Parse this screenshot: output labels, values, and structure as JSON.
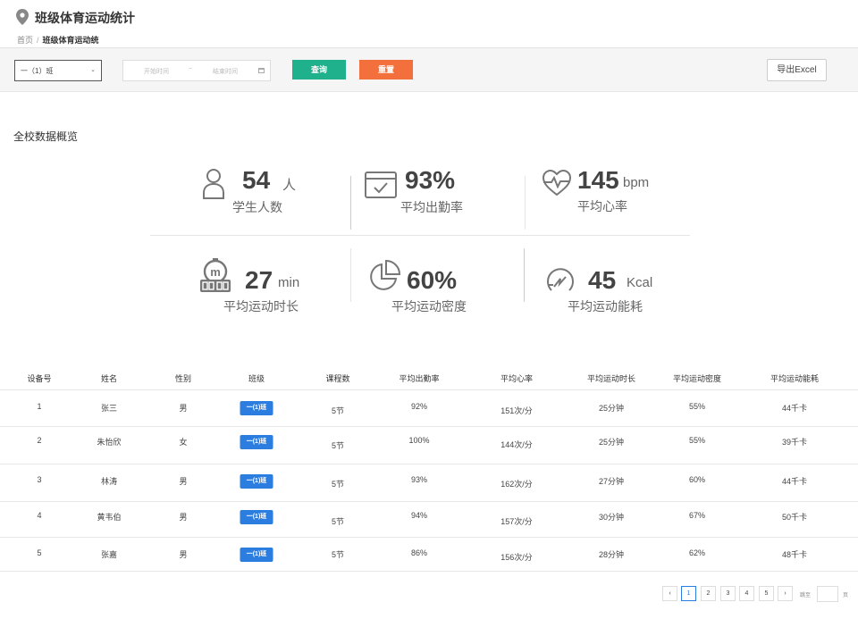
{
  "header": {
    "title": "班级体育运动统计",
    "breadcrumb_home": "首页",
    "breadcrumb_separator": "/",
    "breadcrumb_current": "班级体育运动统"
  },
  "filters": {
    "class_select_value": "一（1）班",
    "start_placeholder": "开始时间",
    "range_separator": "~",
    "end_placeholder": "结束时间",
    "query_label": "查询",
    "reset_label": "重置",
    "export_label": "导出Excel"
  },
  "overview": {
    "title": "全校数据概览",
    "stats": [
      {
        "value": "54",
        "unit": "人",
        "label": "学生人数",
        "icon": "person-icon"
      },
      {
        "value": "93%",
        "unit": "",
        "label": "平均出勤率",
        "icon": "calendar-check-icon"
      },
      {
        "value": "145",
        "unit": "bpm",
        "label": "平均心率",
        "icon": "heart-rate-icon"
      },
      {
        "value": "27",
        "unit": "min",
        "label": "平均运动时长",
        "icon": "stopwatch-icon"
      },
      {
        "value": "60%",
        "unit": "",
        "label": "平均运动密度",
        "icon": "pie-chart-icon"
      },
      {
        "value": "45",
        "unit": "Kcal",
        "label": "平均运动能耗",
        "icon": "energy-gauge-icon"
      }
    ]
  },
  "table": {
    "columns": [
      "设备号",
      "姓名",
      "性别",
      "班级",
      "课程数",
      "平均出勤率",
      "平均心率",
      "平均运动时长",
      "平均运动密度",
      "平均运动能耗"
    ],
    "rows": [
      {
        "device": "1",
        "name": "张三",
        "gender": "男",
        "class": "一(1)班",
        "lessons": "5节",
        "attendance": "92%",
        "heart": "151次/分",
        "duration": "25分钟",
        "density": "55%",
        "energy": "44千卡"
      },
      {
        "device": "2",
        "name": "朱怡欣",
        "gender": "女",
        "class": "一(1)班",
        "lessons": "5节",
        "attendance": "100%",
        "heart": "144次/分",
        "duration": "25分钟",
        "density": "55%",
        "energy": "39千卡"
      },
      {
        "device": "3",
        "name": "林涛",
        "gender": "男",
        "class": "一(1)班",
        "lessons": "5节",
        "attendance": "93%",
        "heart": "162次/分",
        "duration": "27分钟",
        "density": "60%",
        "energy": "44千卡"
      },
      {
        "device": "4",
        "name": "黄韦伯",
        "gender": "男",
        "class": "一(1)班",
        "lessons": "5节",
        "attendance": "94%",
        "heart": "157次/分",
        "duration": "30分钟",
        "density": "67%",
        "energy": "50千卡"
      },
      {
        "device": "5",
        "name": "张嘉",
        "gender": "男",
        "class": "一(1)班",
        "lessons": "5节",
        "attendance": "86%",
        "heart": "156次/分",
        "duration": "28分钟",
        "density": "62%",
        "energy": "48千卡"
      }
    ]
  },
  "pagination": {
    "prev": "‹",
    "pages": [
      "1",
      "2",
      "3",
      "4",
      "5"
    ],
    "current": "1",
    "next": "›",
    "goto_label": "跳至",
    "page_suffix": "页"
  }
}
